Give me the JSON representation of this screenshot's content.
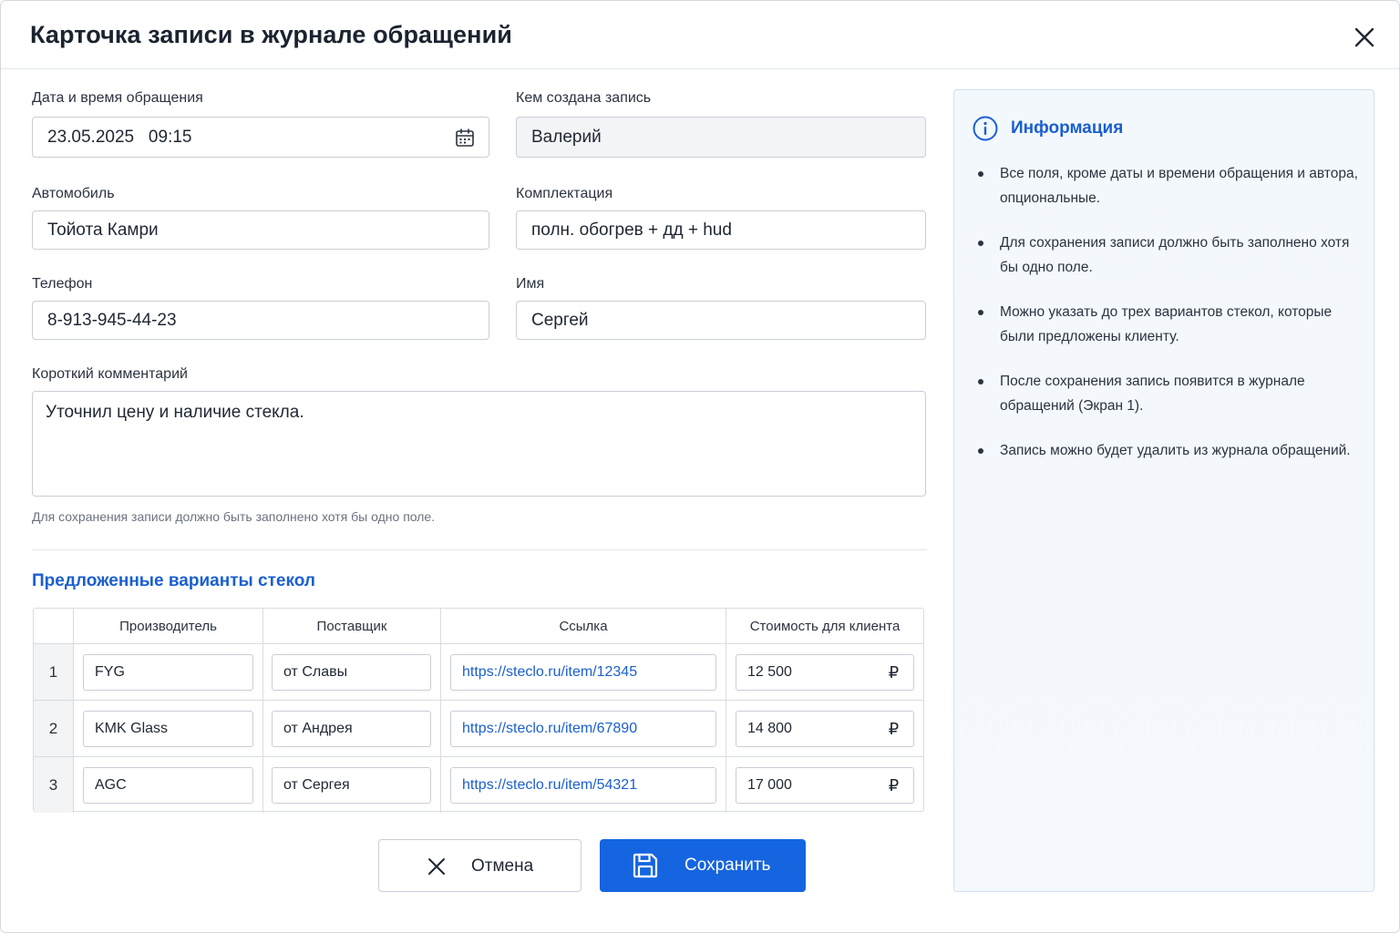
{
  "dialog": {
    "title": "Карточка записи в журнале обращений"
  },
  "form": {
    "datetime": {
      "label": "Дата и время обращения",
      "value": "23.05.2025   09:15"
    },
    "created_by": {
      "label": "Кем создана запись",
      "value": "Валерий"
    },
    "car": {
      "label": "Автомобиль",
      "value": "Тойота Камри"
    },
    "trim": {
      "label": "Комплектация",
      "value": "полн. обогрев + дд + hud"
    },
    "phone": {
      "label": "Телефон",
      "value": "8-913-945-44-23"
    },
    "name": {
      "label": "Имя",
      "value": "Сергей"
    },
    "comment": {
      "label": "Короткий комментарий",
      "value": "Уточнил цену и наличие стекла."
    },
    "hint": "Для сохранения записи должно быть заполнено хотя бы одно поле."
  },
  "glass": {
    "section_title": "Предложенные варианты стекол",
    "headers": [
      "Производитель",
      "Поставщик",
      "Ссылка",
      "Стоимость для клиента"
    ],
    "rows": [
      {
        "num": "1",
        "maker": "FYG",
        "supplier": "от Славы",
        "link": "https://steclo.ru/item/12345",
        "price": "12 500",
        "currency": "₽"
      },
      {
        "num": "2",
        "maker": "KMK Glass",
        "supplier": "от Андрея",
        "link": "https://steclo.ru/item/67890",
        "price": "14 800",
        "currency": "₽"
      },
      {
        "num": "3",
        "maker": "AGC",
        "supplier": "от Сергея",
        "link": "https://steclo.ru/item/54321",
        "price": "17 000",
        "currency": "₽"
      }
    ]
  },
  "actions": {
    "cancel_label": "Отмена",
    "save_label": "Сохранить"
  },
  "info": {
    "title": "Информация",
    "items": [
      "Все поля, кроме даты и времени обращения и автора, опциональные.",
      "Для сохранения записи должно быть заполнено хотя бы одно поле.",
      "Можно указать до трех вариантов стекол, которые были предложены клиенту.",
      "После сохранения запись появится в журнале обращений (Экран 1).",
      "Запись можно будет удалить из журнала обращений."
    ]
  },
  "colors": {
    "accent": "#1565e0",
    "link": "#1a5fd0"
  },
  "icons": [
    "close-icon",
    "calendar-icon",
    "info-icon",
    "cancel-x-icon",
    "save-disk-icon"
  ]
}
